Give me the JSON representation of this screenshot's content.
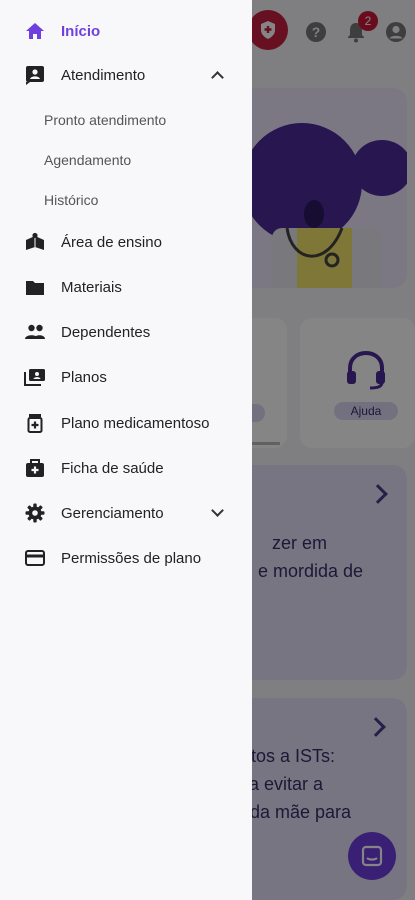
{
  "status": {
    "notifications_count": "2"
  },
  "background": {
    "quick_actions": [
      {
        "label": "Ajuda"
      }
    ],
    "cards": [
      {
        "lines": [
          "zer em",
          "e mordida de"
        ]
      },
      {
        "lines": [
          "tos a ISTs:",
          "a evitar a",
          "da mãe para"
        ]
      }
    ]
  },
  "drawer": {
    "home": {
      "label": "Início"
    },
    "atendimento": {
      "label": "Atendimento",
      "subitems": [
        "Pronto atendimento",
        "Agendamento",
        "Histórico"
      ]
    },
    "items": [
      {
        "label": "Área de ensino",
        "icon": "school-icon"
      },
      {
        "label": "Materiais",
        "icon": "folder-icon"
      },
      {
        "label": "Dependentes",
        "icon": "people-icon"
      },
      {
        "label": "Planos",
        "icon": "cards-icon"
      },
      {
        "label": "Plano medicamentoso",
        "icon": "medication-icon"
      },
      {
        "label": "Ficha de saúde",
        "icon": "medical-bag-icon"
      }
    ],
    "gerenciamento": {
      "label": "Gerenciamento"
    },
    "permissoes": {
      "label": "Permissões de plano"
    }
  },
  "colors": {
    "accent": "#6f3fe0",
    "scrim": "rgba(0,0,0,0.48)",
    "badge": "#c8183a"
  }
}
